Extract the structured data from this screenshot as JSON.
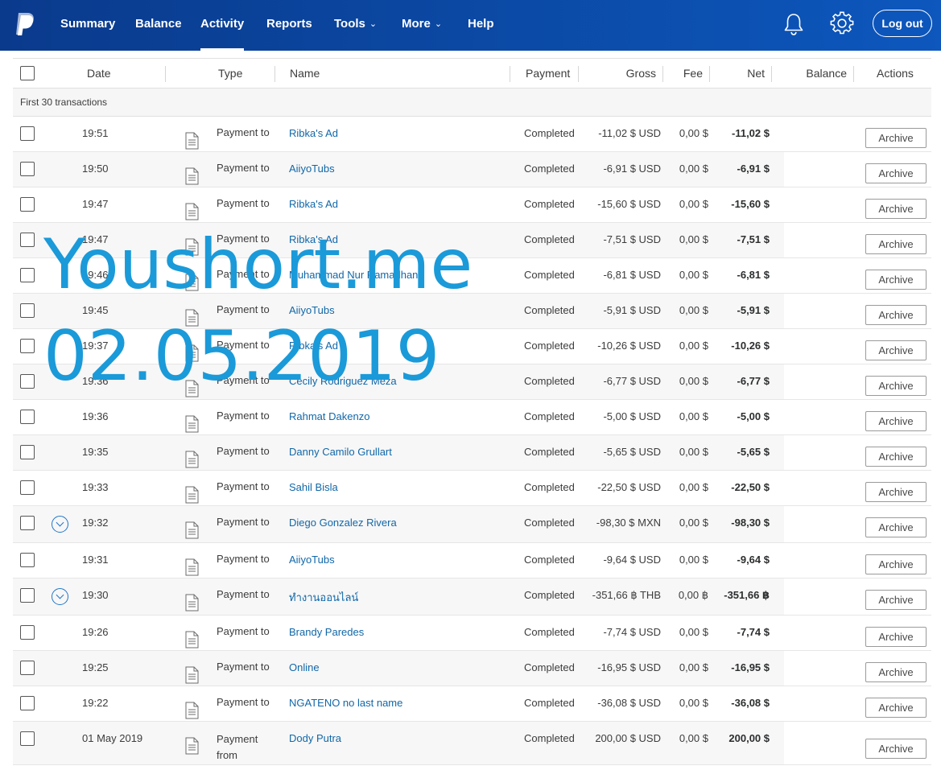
{
  "nav": {
    "items": [
      {
        "label": "Summary",
        "caret": false
      },
      {
        "label": "Balance",
        "caret": false
      },
      {
        "label": "Activity",
        "caret": false
      },
      {
        "label": "Reports",
        "caret": false
      },
      {
        "label": "Tools",
        "caret": true
      },
      {
        "label": "More",
        "caret": true
      },
      {
        "label": "Help",
        "caret": false
      }
    ],
    "active": "Activity",
    "logout_label": "Log out",
    "icons": [
      "paypal-logo",
      "bell-icon",
      "gear-icon"
    ]
  },
  "table": {
    "headers": {
      "date": "Date",
      "type": "Type",
      "name": "Name",
      "payment": "Payment",
      "gross": "Gross",
      "fee": "Fee",
      "net": "Net",
      "balance": "Balance",
      "actions": "Actions"
    },
    "subheader": "First 30 transactions",
    "archive_label": "Archive",
    "rows": [
      {
        "date": "19:51",
        "type": "Payment to",
        "name": "Ribka's Ad",
        "payment": "Completed",
        "gross": "-11,02 $ USD",
        "fee": "0,00 $",
        "net": "-11,02 $",
        "expand": false
      },
      {
        "date": "19:50",
        "type": "Payment to",
        "name": "AiiyoTubs",
        "payment": "Completed",
        "gross": "-6,91 $ USD",
        "fee": "0,00 $",
        "net": "-6,91 $",
        "expand": false
      },
      {
        "date": "19:47",
        "type": "Payment to",
        "name": "Ribka's Ad",
        "payment": "Completed",
        "gross": "-15,60 $ USD",
        "fee": "0,00 $",
        "net": "-15,60 $",
        "expand": false
      },
      {
        "date": "19:47",
        "type": "Payment to",
        "name": "Ribka's Ad",
        "payment": "Completed",
        "gross": "-7,51 $ USD",
        "fee": "0,00 $",
        "net": "-7,51 $",
        "expand": false
      },
      {
        "date": "19:46",
        "type": "Payment to",
        "name": "Muhammad Nur Ramadhan",
        "payment": "Completed",
        "gross": "-6,81 $ USD",
        "fee": "0,00 $",
        "net": "-6,81 $",
        "expand": false
      },
      {
        "date": "19:45",
        "type": "Payment to",
        "name": "AiiyoTubs",
        "payment": "Completed",
        "gross": "-5,91 $ USD",
        "fee": "0,00 $",
        "net": "-5,91 $",
        "expand": false
      },
      {
        "date": "19:37",
        "type": "Payment to",
        "name": "Ribka's Ad",
        "payment": "Completed",
        "gross": "-10,26 $ USD",
        "fee": "0,00 $",
        "net": "-10,26 $",
        "expand": false
      },
      {
        "date": "19:36",
        "type": "Payment to",
        "name": "Cecily Rodriguez Meza",
        "payment": "Completed",
        "gross": "-6,77 $ USD",
        "fee": "0,00 $",
        "net": "-6,77 $",
        "expand": false
      },
      {
        "date": "19:36",
        "type": "Payment to",
        "name": "Rahmat Dakenzo",
        "payment": "Completed",
        "gross": "-5,00 $ USD",
        "fee": "0,00 $",
        "net": "-5,00 $",
        "expand": false
      },
      {
        "date": "19:35",
        "type": "Payment to",
        "name": "Danny Camilo Grullart",
        "payment": "Completed",
        "gross": "-5,65 $ USD",
        "fee": "0,00 $",
        "net": "-5,65 $",
        "expand": false
      },
      {
        "date": "19:33",
        "type": "Payment to",
        "name": "Sahil Bisla",
        "payment": "Completed",
        "gross": "-22,50 $ USD",
        "fee": "0,00 $",
        "net": "-22,50 $",
        "expand": false
      },
      {
        "date": "19:32",
        "type": "Payment to",
        "name": "Diego Gonzalez Rivera",
        "payment": "Completed",
        "gross": "-98,30 $ MXN",
        "fee": "0,00 $",
        "net": "-98,30 $",
        "expand": true
      },
      {
        "date": "19:31",
        "type": "Payment to",
        "name": "AiiyoTubs",
        "payment": "Completed",
        "gross": "-9,64 $ USD",
        "fee": "0,00 $",
        "net": "-9,64 $",
        "expand": false
      },
      {
        "date": "19:30",
        "type": "Payment to",
        "name": "ทำงานออนไลน์",
        "payment": "Completed",
        "gross": "-351,66 ฿ THB",
        "fee": "0,00 ฿",
        "net": "-351,66 ฿",
        "expand": true
      },
      {
        "date": "19:26",
        "type": "Payment to",
        "name": "Brandy Paredes",
        "payment": "Completed",
        "gross": "-7,74 $ USD",
        "fee": "0,00 $",
        "net": "-7,74 $",
        "expand": false
      },
      {
        "date": "19:25",
        "type": "Payment to",
        "name": "Online",
        "payment": "Completed",
        "gross": "-16,95 $ USD",
        "fee": "0,00 $",
        "net": "-16,95 $",
        "expand": false
      },
      {
        "date": "19:22",
        "type": "Payment to",
        "name": "NGATENO no last name",
        "payment": "Completed",
        "gross": "-36,08 $ USD",
        "fee": "0,00 $",
        "net": "-36,08 $",
        "expand": false
      },
      {
        "date": "01 May 2019",
        "type": "Payment from",
        "name": "Dody Putra",
        "payment": "Completed",
        "gross": "200,00 $ USD",
        "fee": "0,00 $",
        "net": "200,00 $",
        "expand": false
      }
    ]
  },
  "watermark": {
    "line1": "Youshort.me",
    "line2": "02.05.2019"
  }
}
